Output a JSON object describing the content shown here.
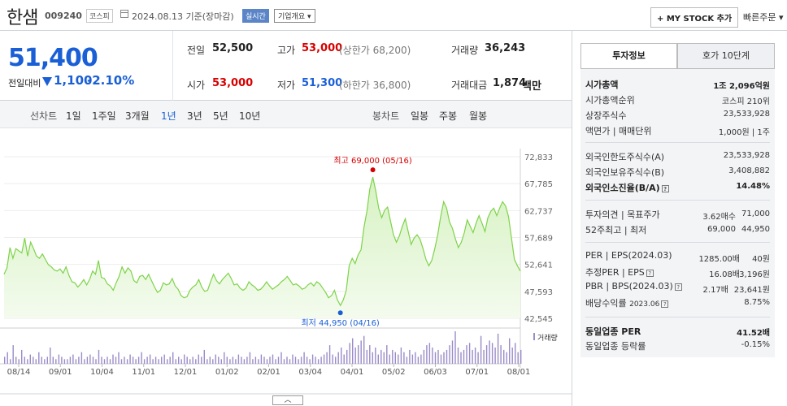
{
  "header": {
    "name": "한샘",
    "code": "009240",
    "market": "코스피",
    "date": "2024.08.13 기준(장마감)",
    "realtime": "실시간",
    "overview": "기업개요 ▾",
    "mystock": "+ MY STOCK 추가",
    "quick_order": "빠른주문 ▾"
  },
  "price": {
    "current": "51,400",
    "change_label": "전일대비",
    "change_value": "1,100",
    "change_pct": "-2.10%"
  },
  "summary": {
    "prev_label": "전일",
    "prev_value": "52,500",
    "high_label": "고가",
    "high_value": "53,000",
    "high_limit": "(상한가 68,200)",
    "volume_label": "거래량",
    "volume_value": "36,243",
    "open_label": "시가",
    "open_value": "53,000",
    "low_label": "저가",
    "low_value": "51,300",
    "low_limit": "(하한가 36,800)",
    "amount_label": "거래대금",
    "amount_value": "1,874",
    "amount_unit": "백만"
  },
  "controls": {
    "line_chart": "선차트",
    "periods": [
      "1일",
      "1주일",
      "3개월",
      "1년",
      "3년",
      "5년",
      "10년"
    ],
    "selected_period": "1년",
    "candle_chart": "봉차트",
    "candle_periods": [
      "일봉",
      "주봉",
      "월봉"
    ]
  },
  "chart_data": {
    "type": "area",
    "y_ticks": [
      "72,833",
      "67,785",
      "62,737",
      "57,689",
      "52,641",
      "47,593",
      "42,545"
    ],
    "ylim": [
      42545,
      72833
    ],
    "x_ticks": [
      "08/14",
      "09/01",
      "10/04",
      "11/01",
      "12/01",
      "01/02",
      "02/01",
      "03/04",
      "04/01",
      "05/02",
      "06/03",
      "07/01",
      "08/01"
    ],
    "series": [
      {
        "values": [
          50800,
          52000,
          55800,
          53800,
          55600,
          55200,
          54800,
          57600,
          54200,
          56800,
          55600,
          54200,
          53800,
          54600,
          53600,
          52600,
          52200,
          51600,
          51400,
          51800,
          51000,
          52200,
          50600,
          49400,
          49200,
          48400,
          49000,
          49800,
          48800,
          49800,
          51400,
          50800,
          53400,
          50200,
          50000,
          49000,
          48600,
          47800,
          49200,
          50400,
          52200,
          51000,
          52000,
          51400,
          49600,
          49200,
          50400,
          50600,
          49800,
          50800,
          49600,
          48400,
          47400,
          47800,
          49200,
          48800,
          49000,
          50000,
          48600,
          48000,
          46800,
          46400,
          46600,
          47800,
          48400,
          48800,
          49800,
          48400,
          47600,
          47800,
          49400,
          50800,
          49600,
          49000,
          49800,
          50400,
          51000,
          50000,
          48800,
          49000,
          48200,
          47800,
          48200,
          49400,
          48800,
          48400,
          47800,
          48000,
          48600,
          49400,
          48600,
          48000,
          48400,
          48800,
          49400,
          49800,
          50400,
          49600,
          48800,
          49000,
          48600,
          48000,
          48200,
          48800,
          49200,
          48600,
          49400,
          49000,
          48200,
          47400,
          46400,
          46800,
          47800,
          46000,
          44950,
          46000,
          47800,
          52400,
          53800,
          52800,
          54400,
          55400,
          59600,
          62600,
          66800,
          69000,
          66400,
          63200,
          61400,
          62800,
          63400,
          60800,
          58200,
          56800,
          58000,
          59800,
          61200,
          58800,
          56400,
          57600,
          58200,
          57400,
          55600,
          53600,
          52400,
          53400,
          55600,
          58200,
          61600,
          64400,
          63200,
          60600,
          59400,
          57400,
          55800,
          56800,
          58600,
          61000,
          59800,
          58600,
          60400,
          61800,
          60400,
          58800,
          61400,
          62600,
          63200,
          61800,
          63200,
          64400,
          63600,
          61600,
          57600,
          53600,
          52400,
          51400
        ]
      }
    ],
    "annotations": [
      {
        "label": "최고 69,000 (05/16)",
        "value": 69000
      },
      {
        "label": "최저 44,950 (04/16)",
        "value": 44950
      }
    ],
    "volume_label": "거래량",
    "volume": [
      3,
      5,
      2,
      8,
      3,
      2,
      6,
      3,
      2,
      4,
      3,
      2,
      5,
      3,
      2,
      3,
      7,
      3,
      2,
      4,
      3,
      2,
      2,
      3,
      4,
      2,
      3,
      5,
      2,
      3,
      4,
      3,
      2,
      6,
      3,
      2,
      3,
      2,
      4,
      3,
      5,
      2,
      3,
      2,
      4,
      3,
      2,
      3,
      5,
      2,
      3,
      4,
      2,
      3,
      2,
      3,
      4,
      2,
      3,
      5,
      2,
      3,
      2,
      4,
      3,
      2,
      3,
      2,
      4,
      3,
      6,
      2,
      3,
      2,
      4,
      3,
      2,
      5,
      3,
      2,
      3,
      2,
      4,
      3,
      2,
      3,
      5,
      2,
      3,
      2,
      4,
      3,
      2,
      3,
      4,
      2,
      3,
      5,
      2,
      3,
      2,
      4,
      3,
      2,
      3,
      5,
      3,
      2,
      4,
      3,
      2,
      3,
      4,
      5,
      8,
      4,
      3,
      5,
      7,
      4,
      6,
      9,
      11,
      7,
      8,
      10,
      12,
      6,
      8,
      5,
      7,
      4,
      6,
      5,
      8,
      4,
      6,
      5,
      4,
      7,
      5,
      3,
      6,
      4,
      5,
      3,
      4,
      6,
      8,
      9,
      7,
      5,
      6,
      4,
      5,
      6,
      8,
      10,
      14,
      7,
      5,
      6,
      8,
      9,
      6,
      7,
      5,
      12,
      6,
      8,
      10,
      9,
      7,
      13,
      8,
      6,
      5,
      11,
      7,
      9,
      5,
      6
    ]
  },
  "invest_info": {
    "tab_active": "투자정보",
    "tab_other": "호가 10단계",
    "market_cap_label": "시가총액",
    "market_cap_value": "1조 2,096억원",
    "rank_label": "시가총액순위",
    "rank_value": "코스피 210위",
    "shares_label": "상장주식수",
    "shares_value": "23,533,928",
    "par_label": "액면가 | 매매단위",
    "par_value": "1,000원 | 1주",
    "foreign_limit_label": "외국인한도주식수(A)",
    "foreign_limit_value": "23,533,928",
    "foreign_hold_label": "외국인보유주식수(B)",
    "foreign_hold_value": "3,408,882",
    "foreign_ratio_label": "외국인소진율(B/A)",
    "foreign_ratio_value": "14.48%",
    "opinion_label": "투자의견 | 목표주가",
    "opinion_value": "3.62매수",
    "target_value": "71,000",
    "w52_label": "52주최고 | 최저",
    "w52_high": "69,000",
    "w52_low": "44,950",
    "per_label": "PER | EPS(2024.03)",
    "per_value": "1285.00배",
    "eps_value": "40원",
    "est_per_label": "추정PER | EPS",
    "est_per_value": "16.08배",
    "est_eps_value": "3,196원",
    "pbr_label": "PBR | BPS(2024.03)",
    "pbr_value": "2.17배",
    "bps_value": "23,641원",
    "div_label": "배당수익률",
    "div_date": "2023.06",
    "div_value": "8.75%",
    "sector_per_label": "동일업종 PER",
    "sector_per_value": "41.52배",
    "sector_rate_label": "동일업종 등락률",
    "sector_rate_value": "-0.15%"
  },
  "colors": {
    "down_blue": "#1a5fd6",
    "up_red": "#d60000",
    "line_green": "#7ed34a",
    "fill_green": "#e6f7d8",
    "volume_purple": "#9b8bc9"
  }
}
